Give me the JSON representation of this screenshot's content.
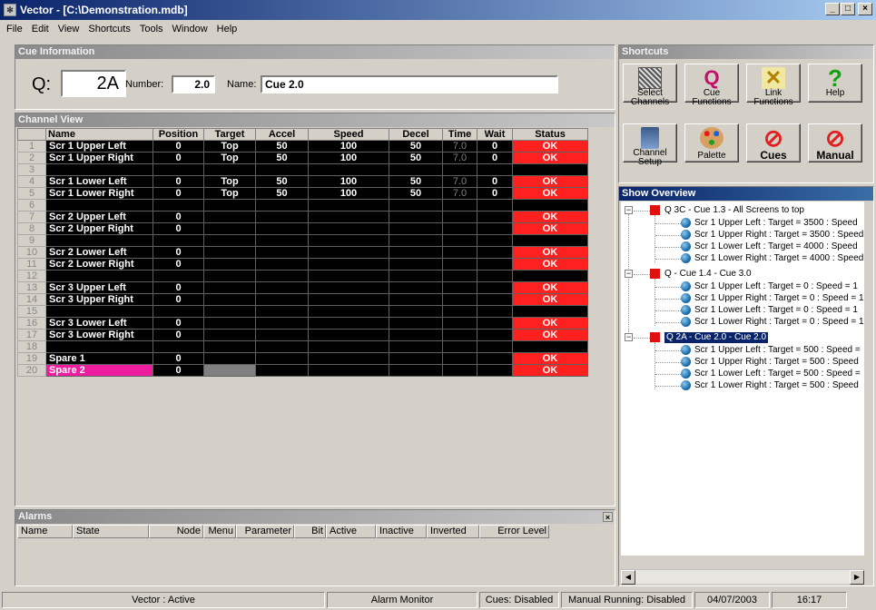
{
  "window": {
    "title": "Vector - [C:\\Demonstration.mdb]"
  },
  "menu": [
    "File",
    "Edit",
    "View",
    "Shortcuts",
    "Tools",
    "Window",
    "Help"
  ],
  "cue_info": {
    "header": "Cue Information",
    "q_label": "Q:",
    "q_value": "2A",
    "number_label": "Number:",
    "number_value": "2.0",
    "name_label": "Name:",
    "name_value": "Cue 2.0"
  },
  "channel_view": {
    "header": "Channel View",
    "columns": [
      "",
      "Name",
      "Position",
      "Target",
      "Accel",
      "Speed",
      "Decel",
      "Time",
      "Wait",
      "Status"
    ],
    "rows": [
      {
        "n": "1",
        "name": "Scr 1 Upper Left",
        "pos": "0",
        "target": "Top",
        "accel": "50",
        "speed": "100",
        "decel": "50",
        "time": "7.0",
        "wait": "0",
        "status": "OK"
      },
      {
        "n": "2",
        "name": "Scr 1 Upper Right",
        "pos": "0",
        "target": "Top",
        "accel": "50",
        "speed": "100",
        "decel": "50",
        "time": "7.0",
        "wait": "0",
        "status": "OK"
      },
      {
        "n": "3",
        "name": "",
        "pos": "",
        "target": "",
        "accel": "",
        "speed": "",
        "decel": "",
        "time": "",
        "wait": "",
        "status": ""
      },
      {
        "n": "4",
        "name": "Scr 1 Lower Left",
        "pos": "0",
        "target": "Top",
        "accel": "50",
        "speed": "100",
        "decel": "50",
        "time": "7.0",
        "wait": "0",
        "status": "OK"
      },
      {
        "n": "5",
        "name": "Scr 1 Lower Right",
        "pos": "0",
        "target": "Top",
        "accel": "50",
        "speed": "100",
        "decel": "50",
        "time": "7.0",
        "wait": "0",
        "status": "OK"
      },
      {
        "n": "6",
        "name": "",
        "pos": "",
        "target": "",
        "accel": "",
        "speed": "",
        "decel": "",
        "time": "",
        "wait": "",
        "status": ""
      },
      {
        "n": "7",
        "name": "Scr 2 Upper Left",
        "pos": "0",
        "target": "",
        "accel": "",
        "speed": "",
        "decel": "",
        "time": "",
        "wait": "",
        "status": "OK"
      },
      {
        "n": "8",
        "name": "Scr 2 Upper Right",
        "pos": "0",
        "target": "",
        "accel": "",
        "speed": "",
        "decel": "",
        "time": "",
        "wait": "",
        "status": "OK"
      },
      {
        "n": "9",
        "name": "",
        "pos": "",
        "target": "",
        "accel": "",
        "speed": "",
        "decel": "",
        "time": "",
        "wait": "",
        "status": ""
      },
      {
        "n": "10",
        "name": "Scr 2 Lower Left",
        "pos": "0",
        "target": "",
        "accel": "",
        "speed": "",
        "decel": "",
        "time": "",
        "wait": "",
        "status": "OK"
      },
      {
        "n": "11",
        "name": "Scr 2 Lower Right",
        "pos": "0",
        "target": "",
        "accel": "",
        "speed": "",
        "decel": "",
        "time": "",
        "wait": "",
        "status": "OK"
      },
      {
        "n": "12",
        "name": "",
        "pos": "",
        "target": "",
        "accel": "",
        "speed": "",
        "decel": "",
        "time": "",
        "wait": "",
        "status": ""
      },
      {
        "n": "13",
        "name": "Scr 3 Upper Left",
        "pos": "0",
        "target": "",
        "accel": "",
        "speed": "",
        "decel": "",
        "time": "",
        "wait": "",
        "status": "OK"
      },
      {
        "n": "14",
        "name": "Scr 3 Upper Right",
        "pos": "0",
        "target": "",
        "accel": "",
        "speed": "",
        "decel": "",
        "time": "",
        "wait": "",
        "status": "OK"
      },
      {
        "n": "15",
        "name": "",
        "pos": "",
        "target": "",
        "accel": "",
        "speed": "",
        "decel": "",
        "time": "",
        "wait": "",
        "status": ""
      },
      {
        "n": "16",
        "name": "Scr 3 Lower Left",
        "pos": "0",
        "target": "",
        "accel": "",
        "speed": "",
        "decel": "",
        "time": "",
        "wait": "",
        "status": "OK"
      },
      {
        "n": "17",
        "name": "Scr 3 Lower Right",
        "pos": "0",
        "target": "",
        "accel": "",
        "speed": "",
        "decel": "",
        "time": "",
        "wait": "",
        "status": "OK"
      },
      {
        "n": "18",
        "name": "",
        "pos": "",
        "target": "",
        "accel": "",
        "speed": "",
        "decel": "",
        "time": "",
        "wait": "",
        "status": ""
      },
      {
        "n": "19",
        "name": "Spare 1",
        "pos": "0",
        "target": "",
        "accel": "",
        "speed": "",
        "decel": "",
        "time": "",
        "wait": "",
        "status": "OK"
      },
      {
        "n": "20",
        "name": "Spare 2",
        "pos": "0",
        "target": "",
        "accel": "",
        "speed": "",
        "decel": "",
        "time": "",
        "wait": "",
        "status": "OK"
      }
    ]
  },
  "alarms": {
    "header": "Alarms",
    "close_glyph": "×",
    "columns": [
      "Name",
      "State",
      "Node",
      "Menu",
      "Parameter",
      "Bit",
      "Active",
      "Inactive",
      "Inverted",
      "Error Level"
    ]
  },
  "shortcuts": {
    "header": "Shortcuts",
    "buttons": [
      {
        "label1": "Select",
        "label2": "Channels",
        "icon": "grid-icon"
      },
      {
        "label1": "Cue",
        "label2": "Functions",
        "icon": "q-icon",
        "glyph": "Q"
      },
      {
        "label1": "Link",
        "label2": "Functions",
        "icon": "link-icon",
        "glyph": "✕"
      },
      {
        "label1": "Help",
        "label2": "",
        "icon": "help-icon",
        "glyph": "?"
      },
      {
        "label1": "Channel",
        "label2": "Setup",
        "icon": "tools-icon"
      },
      {
        "label1": "Palette",
        "label2": "",
        "icon": "palette-icon"
      },
      {
        "label1": "Cues",
        "label2": "",
        "icon": "no-entry-icon",
        "glyph": "⊘"
      },
      {
        "label1": "Manual",
        "label2": "",
        "icon": "no-entry-icon",
        "glyph": "⊘"
      }
    ]
  },
  "show_overview": {
    "header": "Show Overview",
    "groups": [
      {
        "title": "Q 3C - Cue 1.3 - All Screens to top",
        "items": [
          "Scr 1 Upper Left : Target = 3500 : Speed",
          "Scr 1 Upper Right : Target = 3500 : Speed",
          "Scr 1 Lower Left : Target = 4000 : Speed",
          "Scr 1 Lower Right : Target = 4000 : Speed"
        ]
      },
      {
        "title": "Q  - Cue 1.4 - Cue 3.0",
        "items": [
          "Scr 1 Upper Left : Target = 0 : Speed = 1",
          "Scr 1 Upper Right : Target = 0 : Speed = 1",
          "Scr 1 Lower Left : Target = 0 : Speed = 1",
          "Scr 1 Lower Right : Target = 0 : Speed = 1"
        ]
      },
      {
        "title": "Q 2A - Cue 2.0 - Cue 2.0",
        "items": [
          "Scr 1 Upper Left : Target = 500 : Speed =",
          "Scr 1 Upper Right : Target = 500 : Speed",
          "Scr 1 Lower Left : Target = 500 : Speed =",
          "Scr 1 Lower Right : Target = 500 : Speed"
        ]
      }
    ]
  },
  "status_bar": {
    "vector": "Vector : Active",
    "alarm": "Alarm Monitor",
    "cues": "Cues: Disabled",
    "manual": "Manual Running: Disabled",
    "date": "04/07/2003",
    "time": "16:17"
  },
  "colors": {
    "ok_red": "#ff2020",
    "pink": "#ee1c9e",
    "title_blue": "#0a246a"
  }
}
